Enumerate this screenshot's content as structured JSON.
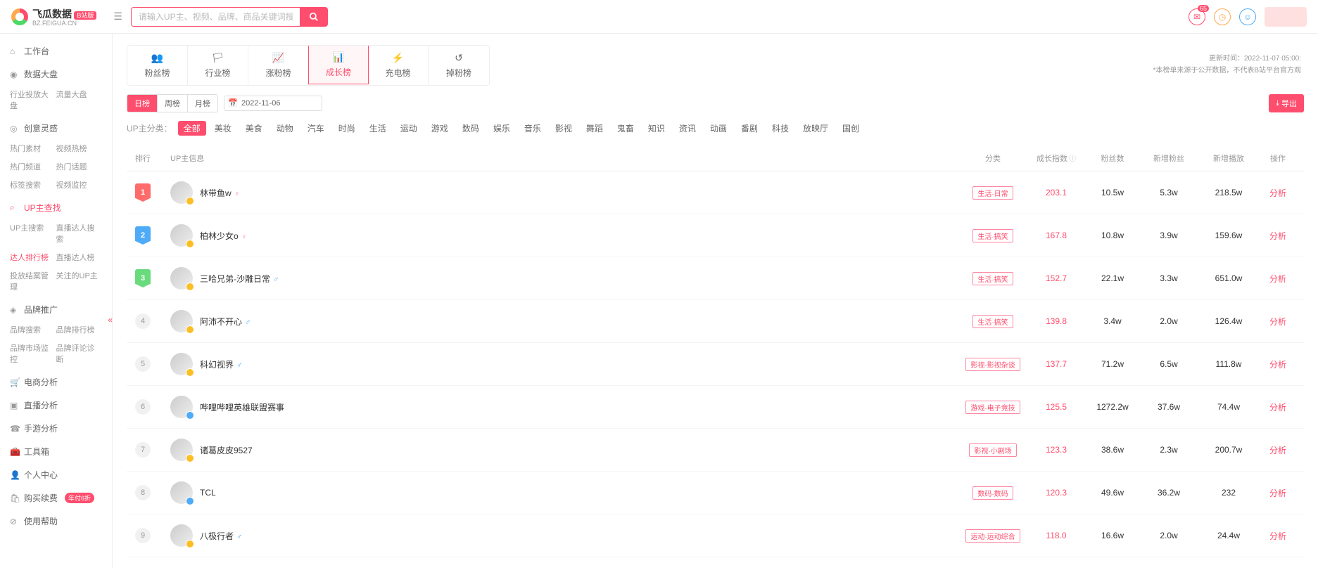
{
  "header": {
    "logo_main": "飞瓜数据",
    "logo_sub": "BZ.FEIGUA.CN",
    "logo_badge": "B站版",
    "search_placeholder": "请输入UP主、视频、品牌、商品关键词搜索",
    "notif_count": "65"
  },
  "sidebar": {
    "worktable": "工作台",
    "data_panel": {
      "title": "数据大盘",
      "items": [
        "行业投放大盘",
        "流量大盘"
      ]
    },
    "creative": {
      "title": "创意灵感",
      "items": [
        "热门素材",
        "视频热榜",
        "热门频道",
        "热门话题",
        "标签搜索",
        "视频监控"
      ]
    },
    "up_search": {
      "title": "UP主查找",
      "items": [
        "UP主搜索",
        "直播达人搜索",
        "达人排行榜",
        "直播达人榜",
        "投放结案管理",
        "关注的UP主"
      ]
    },
    "brand": {
      "title": "品牌推广",
      "items": [
        "品牌搜索",
        "品牌排行榜",
        "品牌市场监控",
        "品牌评论诊断"
      ]
    },
    "ecom": "电商分析",
    "live": "直播分析",
    "mobile": "手游分析",
    "toolbox": "工具箱",
    "personal": "个人中心",
    "purchase": "购买续费",
    "purchase_badge": "年付6折",
    "help": "使用帮助"
  },
  "rank_tabs": [
    "粉丝榜",
    "行业榜",
    "涨粉榜",
    "成长榜",
    "充电榜",
    "掉粉榜"
  ],
  "rank_tabs_active": 3,
  "meta": {
    "update_time": "更新时间：2022-11-07 05:00:",
    "disclaimer": "*本榜单来源于公开数据，不代表B站平台官方观"
  },
  "period_tabs": [
    "日榜",
    "周榜",
    "月榜"
  ],
  "date_value": "2022-11-06",
  "export_label": "导出",
  "cat_label": "UP主分类：",
  "categories": [
    "全部",
    "美妆",
    "美食",
    "动物",
    "汽车",
    "时尚",
    "生活",
    "运动",
    "游戏",
    "数码",
    "娱乐",
    "音乐",
    "影视",
    "舞蹈",
    "鬼畜",
    "知识",
    "资讯",
    "动画",
    "番剧",
    "科技",
    "放映厅",
    "国创"
  ],
  "table": {
    "headers": {
      "rank": "排行",
      "info": "UP主信息",
      "cat": "分类",
      "score": "成长指数",
      "fans": "粉丝数",
      "newfans": "新增粉丝",
      "newplay": "新增播放",
      "op": "操作"
    },
    "op_label": "分析",
    "rows": [
      {
        "rank": 1,
        "name": "林带鱼w",
        "gender": "f",
        "lv": "gold",
        "cat": "生活·日常",
        "score": "203.1",
        "fans": "10.5w",
        "newfans": "5.3w",
        "newplay": "218.5w"
      },
      {
        "rank": 2,
        "name": "柏林少女o",
        "gender": "f",
        "lv": "gold",
        "cat": "生活·搞笑",
        "score": "167.8",
        "fans": "10.8w",
        "newfans": "3.9w",
        "newplay": "159.6w"
      },
      {
        "rank": 3,
        "name": "三哈兄弟-沙雕日常",
        "gender": "m",
        "lv": "gold",
        "cat": "生活·搞笑",
        "score": "152.7",
        "fans": "22.1w",
        "newfans": "3.3w",
        "newplay": "651.0w"
      },
      {
        "rank": 4,
        "name": "阿沛不开心",
        "gender": "m",
        "lv": "gold",
        "cat": "生活·搞笑",
        "score": "139.8",
        "fans": "3.4w",
        "newfans": "2.0w",
        "newplay": "126.4w"
      },
      {
        "rank": 5,
        "name": "科幻视界",
        "gender": "m",
        "lv": "gold",
        "cat": "影视·影视杂谈",
        "score": "137.7",
        "fans": "71.2w",
        "newfans": "6.5w",
        "newplay": "111.8w"
      },
      {
        "rank": 6,
        "name": "哔哩哔哩英雄联盟赛事",
        "gender": "",
        "lv": "blue",
        "cat": "游戏·电子竞技",
        "score": "125.5",
        "fans": "1272.2w",
        "newfans": "37.6w",
        "newplay": "74.4w"
      },
      {
        "rank": 7,
        "name": "诸葛皮皮9527",
        "gender": "",
        "lv": "gold",
        "cat": "影视·小剧场",
        "score": "123.3",
        "fans": "38.6w",
        "newfans": "2.3w",
        "newplay": "200.7w"
      },
      {
        "rank": 8,
        "name": "TCL",
        "gender": "",
        "lv": "blue",
        "cat": "数码·数码",
        "score": "120.3",
        "fans": "49.6w",
        "newfans": "36.2w",
        "newplay": "232"
      },
      {
        "rank": 9,
        "name": "八极行者",
        "gender": "m",
        "lv": "gold",
        "cat": "运动·运动综合",
        "score": "118.0",
        "fans": "16.6w",
        "newfans": "2.0w",
        "newplay": "24.4w"
      }
    ]
  }
}
